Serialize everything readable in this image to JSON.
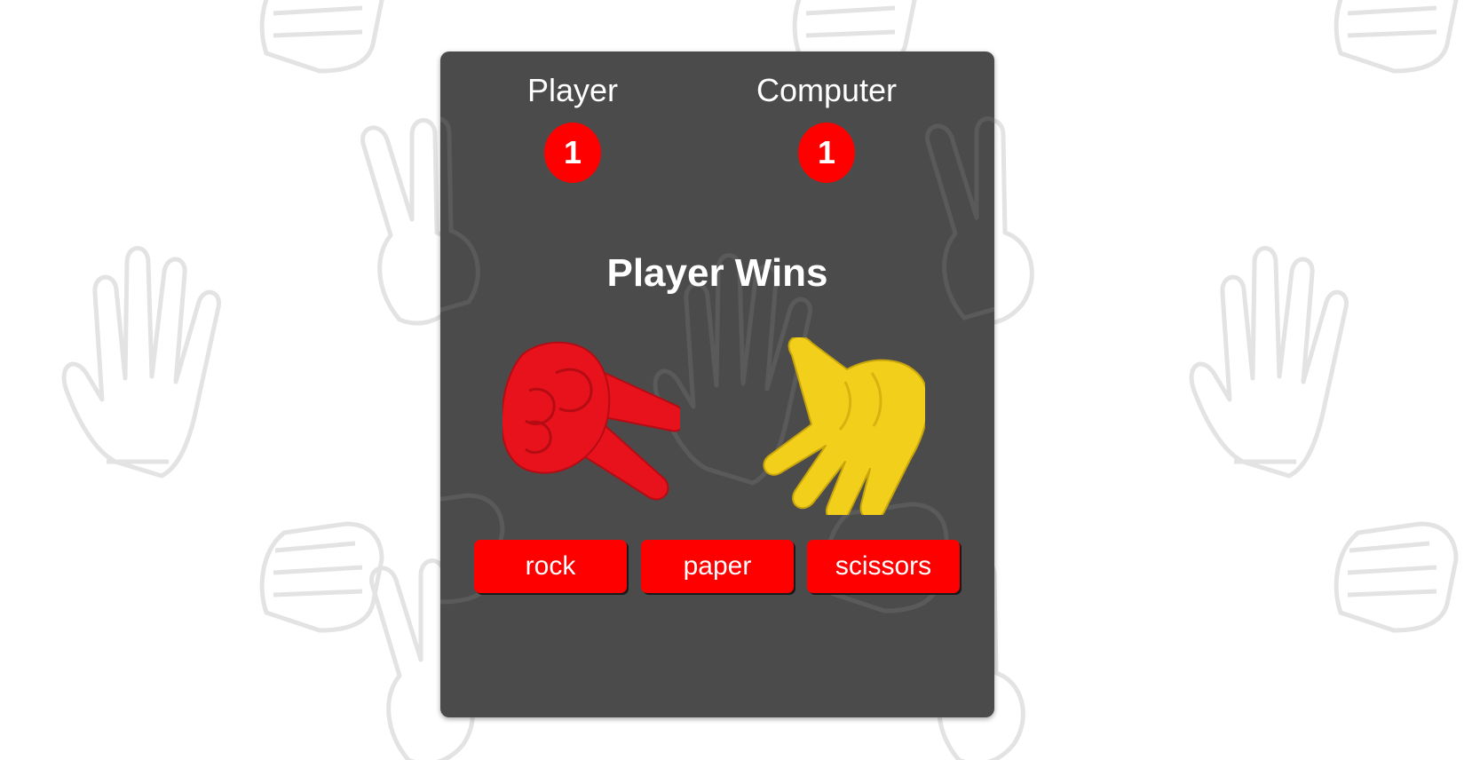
{
  "scoreboard": {
    "player_label": "Player",
    "player_score": "1",
    "computer_label": "Computer",
    "computer_score": "1"
  },
  "result": {
    "text": "Player Wins"
  },
  "hands": {
    "player_choice_icon": "scissors-hand-icon",
    "computer_choice_icon": "paper-hand-icon",
    "player_color": "#e8121d",
    "computer_color": "#f2cf1a"
  },
  "controls": {
    "rock_label": "rock",
    "paper_label": "paper",
    "scissors_label": "scissors"
  },
  "colors": {
    "accent": "#ff0000",
    "card": "#4b4b4b",
    "background": "#ffffff"
  }
}
